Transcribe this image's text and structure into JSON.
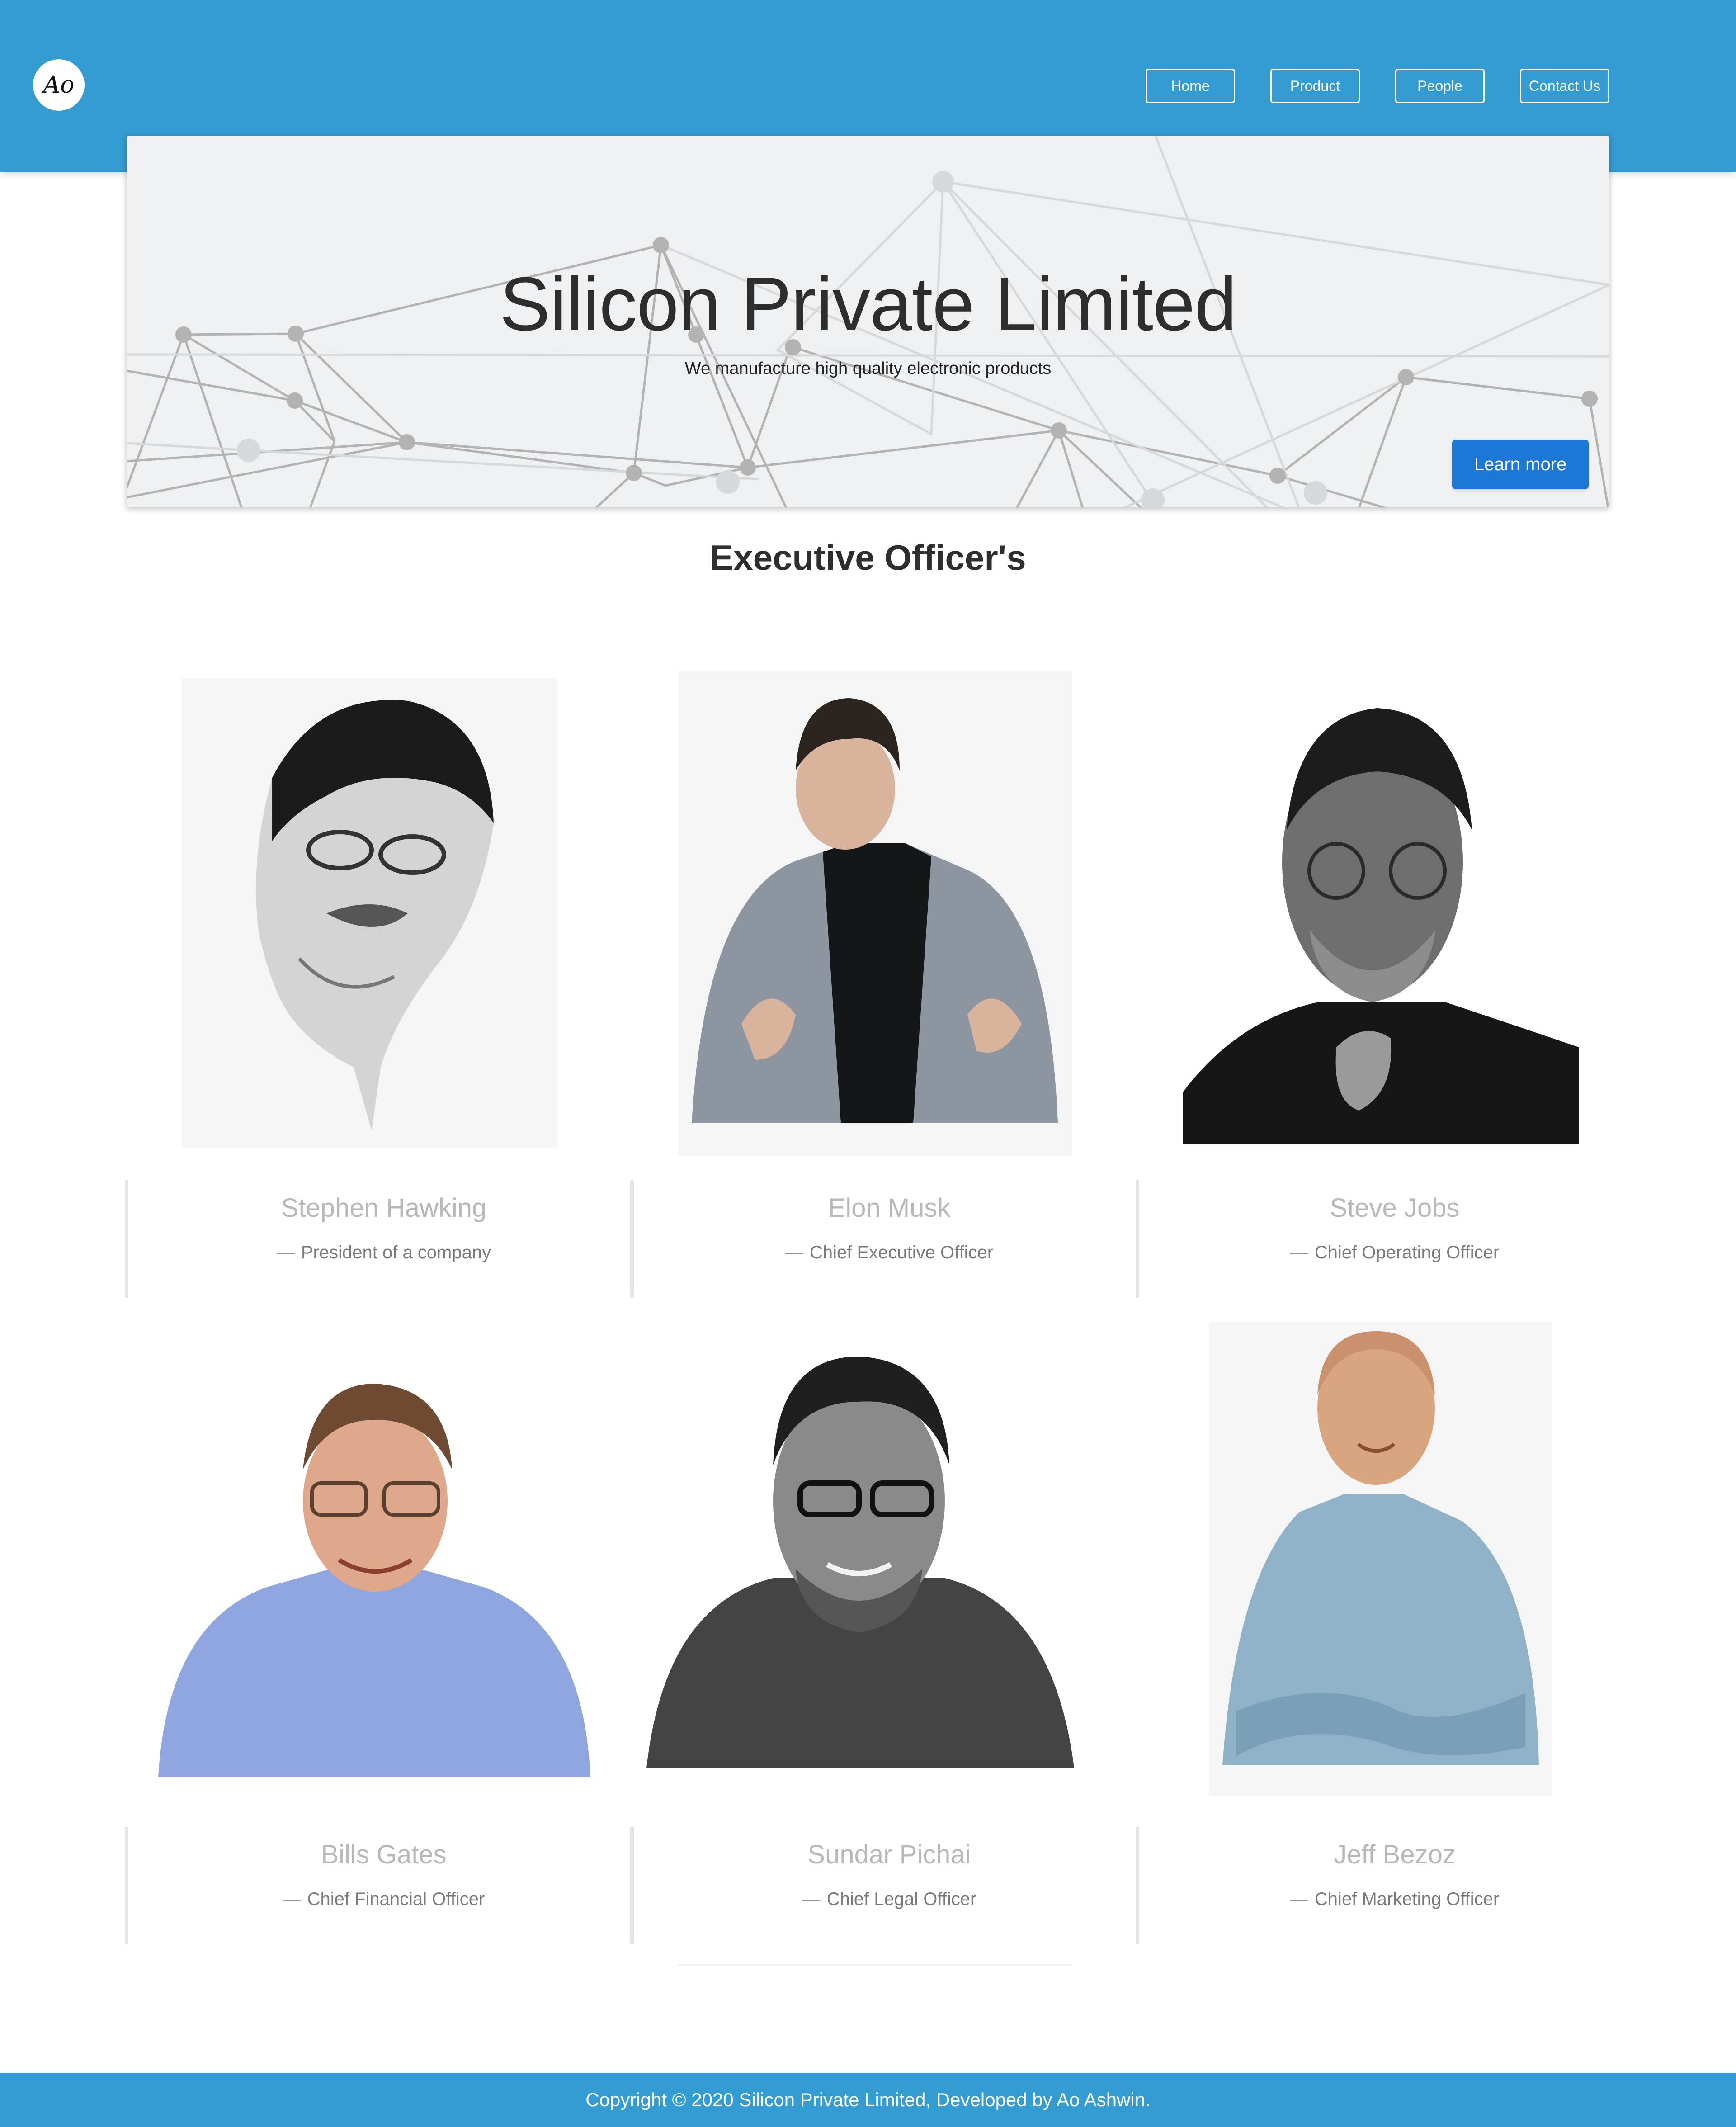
{
  "header": {
    "logo_text": "Ao",
    "nav": [
      "Home",
      "Product",
      "People",
      "Contact Us"
    ]
  },
  "hero": {
    "title": "Silicon Private Limited",
    "tagline": "We manufacture high quality electronic products",
    "cta": "Learn more"
  },
  "section": {
    "title": "Executive Officer's"
  },
  "officers": [
    {
      "name": "Stephen Hawking",
      "role": "President of a company"
    },
    {
      "name": "Elon Musk",
      "role": "Chief Executive Officer"
    },
    {
      "name": "Steve Jobs",
      "role": "Chief Operating Officer"
    },
    {
      "name": "Bills Gates",
      "role": "Chief Financial Officer"
    },
    {
      "name": "Sundar Pichai",
      "role": "Chief Legal Officer"
    },
    {
      "name": "Jeff Bezoz",
      "role": "Chief Marketing Officer"
    }
  ],
  "footer": {
    "text": "Copyright © 2020 Silicon Private Limited, Developed by Ao Ashwin."
  },
  "colors": {
    "brand": "#339cd3",
    "cta": "#1b78d6",
    "hero_bg": "#eff0f2"
  }
}
